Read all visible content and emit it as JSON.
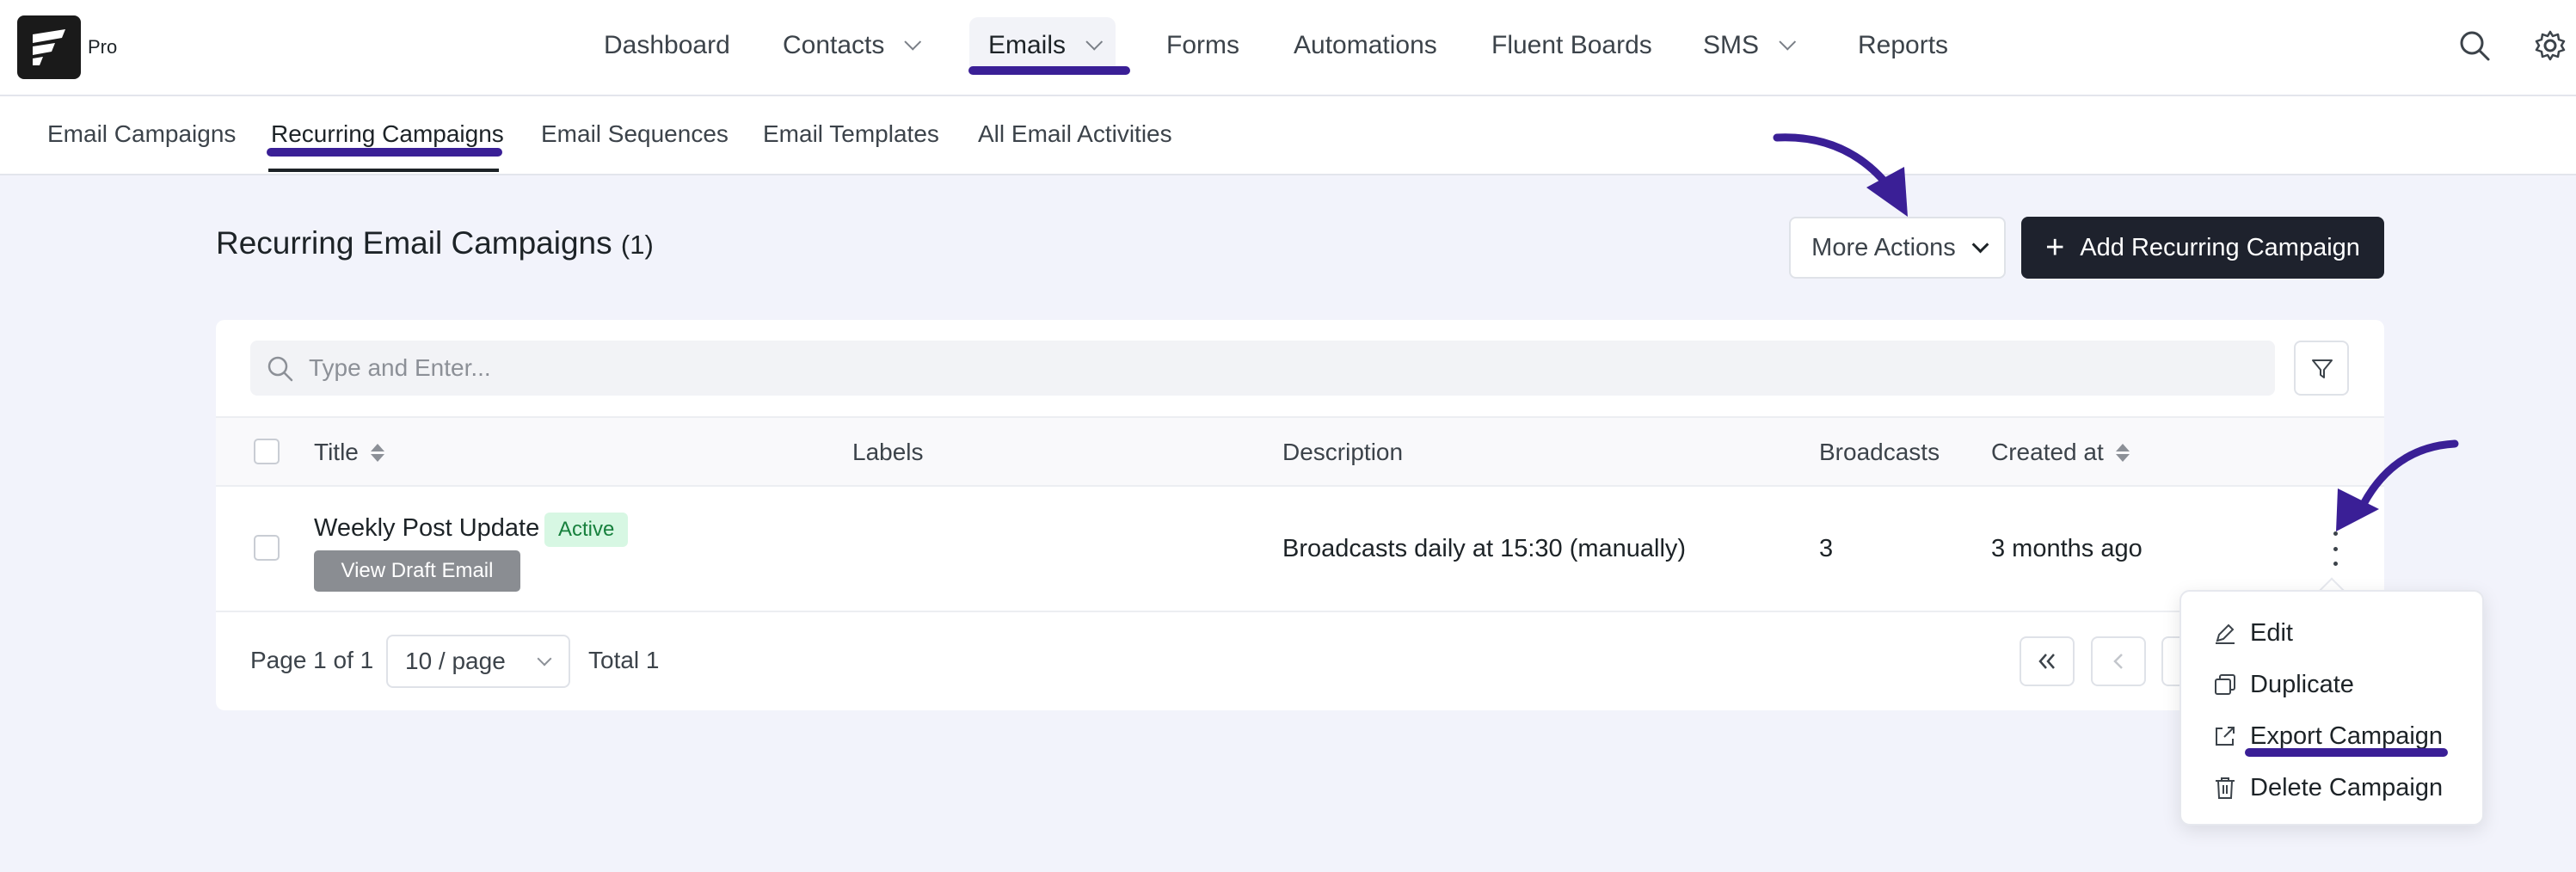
{
  "brand": {
    "badge": "Pro"
  },
  "nav": {
    "items": [
      {
        "label": "Dashboard"
      },
      {
        "label": "Contacts"
      },
      {
        "label": "Emails"
      },
      {
        "label": "Forms"
      },
      {
        "label": "Automations"
      },
      {
        "label": "Fluent Boards"
      },
      {
        "label": "SMS"
      },
      {
        "label": "Reports"
      }
    ],
    "active": "Emails"
  },
  "subnav": {
    "items": [
      {
        "label": "Email Campaigns"
      },
      {
        "label": "Recurring Campaigns"
      },
      {
        "label": "Email Sequences"
      },
      {
        "label": "Email Templates"
      },
      {
        "label": "All Email Activities"
      }
    ],
    "active": "Recurring Campaigns"
  },
  "page": {
    "title": "Recurring Email Campaigns",
    "count": "(1)",
    "more_actions": "More Actions",
    "add_button": "Add Recurring Campaign"
  },
  "search": {
    "placeholder": "Type and Enter..."
  },
  "table": {
    "columns": [
      "Title",
      "Labels",
      "Description",
      "Broadcasts",
      "Created at"
    ],
    "rows": [
      {
        "title": "Weekly Post Update",
        "status": "Active",
        "draft_button": "View Draft Email",
        "description": "Broadcasts daily at 15:30 (manually)",
        "broadcasts": "3",
        "created_at": "3 months ago"
      }
    ]
  },
  "pagination": {
    "page_info": "Page 1 of 1",
    "page_size": "10 / page",
    "total": "Total 1"
  },
  "row_menu": {
    "items": [
      {
        "label": "Edit",
        "icon": "pencil-icon"
      },
      {
        "label": "Duplicate",
        "icon": "copy-icon"
      },
      {
        "label": "Export Campaign",
        "icon": "export-icon"
      },
      {
        "label": "Delete Campaign",
        "icon": "trash-icon"
      }
    ]
  },
  "colors": {
    "accent": "#3a1f96",
    "primary_button": "#1e222d",
    "status_active_bg": "#d7f7e3",
    "status_active_text": "#17803d"
  }
}
